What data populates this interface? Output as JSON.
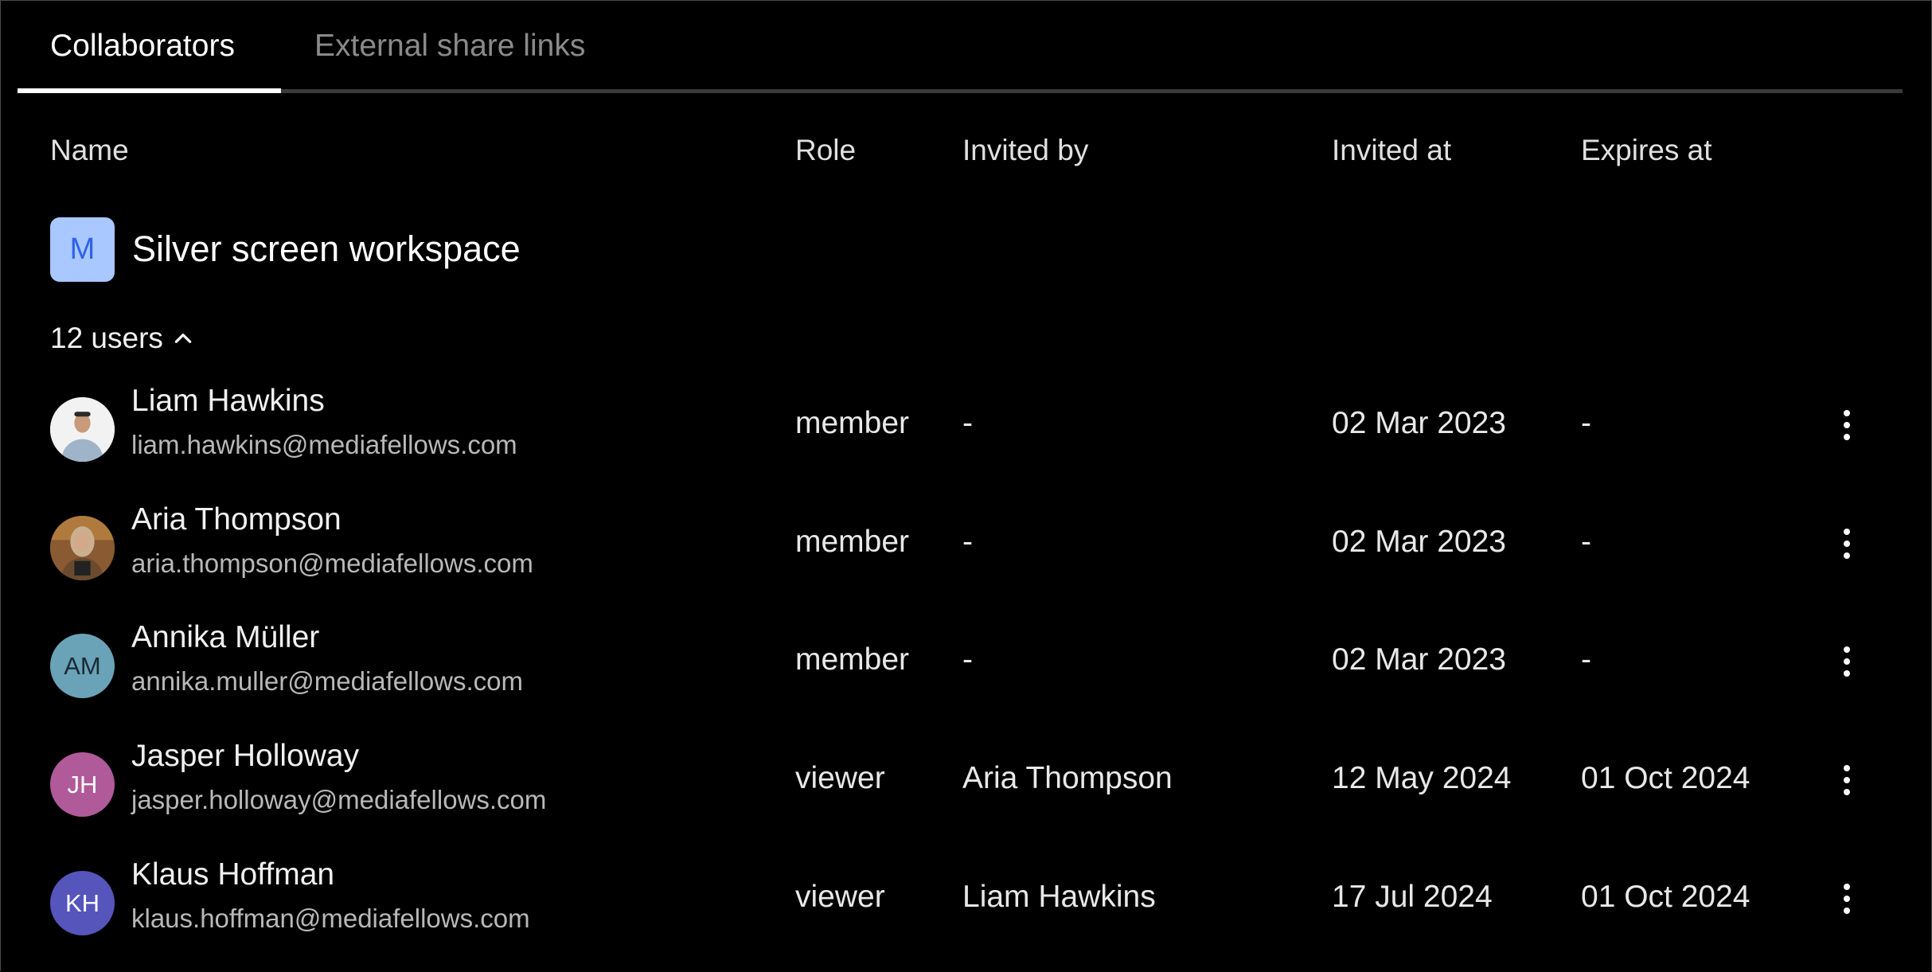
{
  "tabs": [
    {
      "label": "Collaborators",
      "active": true
    },
    {
      "label": "External share links",
      "active": false
    }
  ],
  "table": {
    "headers": {
      "name": "Name",
      "role": "Role",
      "invited_by": "Invited by",
      "invited_at": "Invited at",
      "expires_at": "Expires at"
    }
  },
  "workspace": {
    "initial": "M",
    "title": "Silver screen workspace",
    "tile_bg": "#a8c8ff",
    "tile_fg": "#2f62e8"
  },
  "users_toggle": {
    "label": "12 users",
    "icon": "chevron-up-icon",
    "expanded": true
  },
  "rows": [
    {
      "name": "Liam Hawkins",
      "email": "liam.hawkins@mediafellows.com",
      "avatar_type": "photo",
      "initials": "",
      "avatar_bg": "#f2f2f2",
      "avatar_fg": "#000000",
      "role": "member",
      "invited_by": "-",
      "invited_at": "02 Mar 2023",
      "expires_at": "-"
    },
    {
      "name": "Aria Thompson",
      "email": "aria.thompson@mediafellows.com",
      "avatar_type": "photo",
      "initials": "",
      "avatar_bg": "#8a5a32",
      "avatar_fg": "#000000",
      "role": "member",
      "invited_by": "-",
      "invited_at": "02 Mar 2023",
      "expires_at": "-"
    },
    {
      "name": "Annika Müller",
      "email": "annika.muller@mediafellows.com",
      "avatar_type": "initials",
      "initials": "AM",
      "avatar_bg": "#6aa3b8",
      "avatar_fg": "#1a2a33",
      "role": "member",
      "invited_by": "-",
      "invited_at": "02 Mar 2023",
      "expires_at": "-"
    },
    {
      "name": "Jasper Holloway",
      "email": "jasper.holloway@mediafellows.com",
      "avatar_type": "initials",
      "initials": "JH",
      "avatar_bg": "#b05a9a",
      "avatar_fg": "#ffffff",
      "role": "viewer",
      "invited_by": "Aria Thompson",
      "invited_at": "12 May 2024",
      "expires_at": "01 Oct 2024"
    },
    {
      "name": "Klaus Hoffman",
      "email": "klaus.hoffman@mediafellows.com",
      "avatar_type": "initials",
      "initials": "KH",
      "avatar_bg": "#5555bb",
      "avatar_fg": "#ffffff",
      "role": "viewer",
      "invited_by": "Liam Hawkins",
      "invited_at": "17 Jul 2024",
      "expires_at": "01 Oct 2024"
    }
  ],
  "row_action_icon": "more-vertical-icon"
}
